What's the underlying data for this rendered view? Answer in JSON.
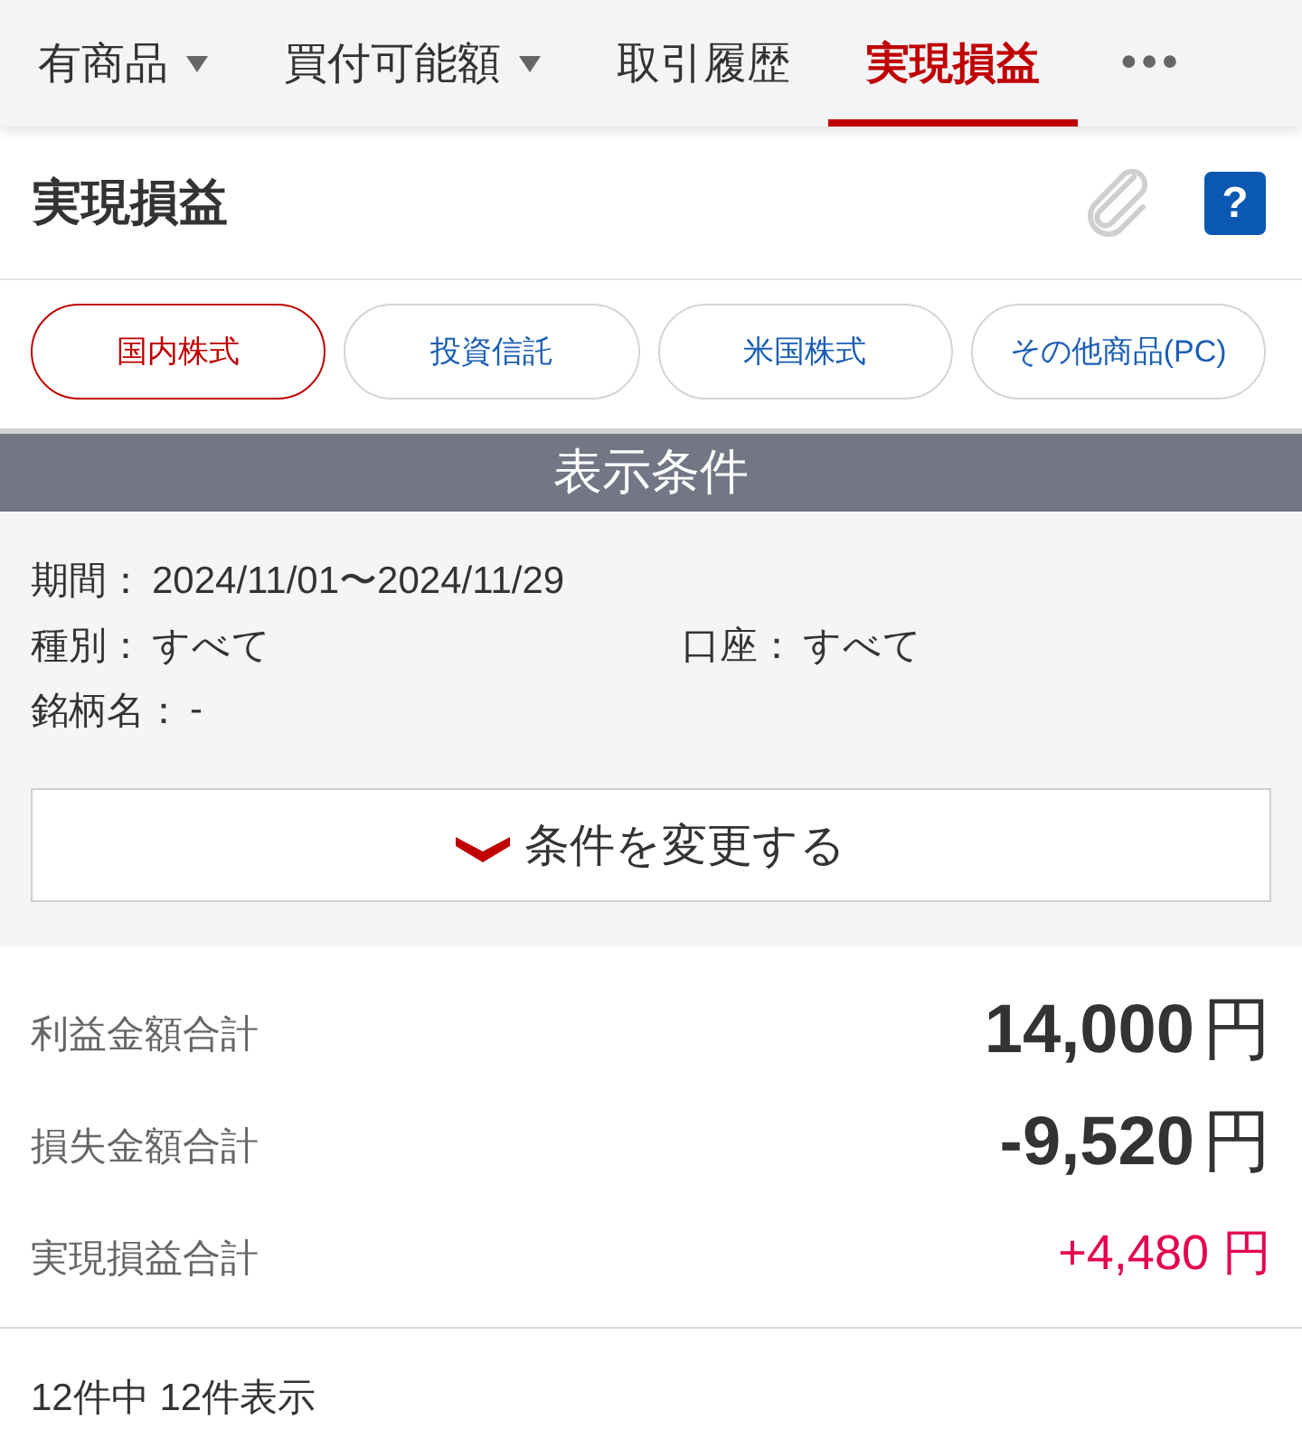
{
  "nav": {
    "tabs": [
      {
        "label": "有商品",
        "dropdown": true,
        "selected": false
      },
      {
        "label": "買付可能額",
        "dropdown": true,
        "selected": false
      },
      {
        "label": "取引履歴",
        "dropdown": false,
        "selected": false
      },
      {
        "label": "実現損益",
        "dropdown": false,
        "selected": true
      }
    ],
    "more": "•••"
  },
  "header": {
    "title": "実現損益",
    "help": "?"
  },
  "categories": [
    {
      "label": "国内株式",
      "selected": true
    },
    {
      "label": "投資信託",
      "selected": false
    },
    {
      "label": "米国株式",
      "selected": false
    },
    {
      "label": "その他商品(PC)",
      "selected": false
    }
  ],
  "conditions": {
    "title": "表示条件",
    "rows": [
      [
        {
          "label": "期間：",
          "value": "2024/11/01〜2024/11/29"
        }
      ],
      [
        {
          "label": "種別：",
          "value": "すべて"
        },
        {
          "label": "口座：",
          "value": "すべて"
        }
      ],
      [
        {
          "label": "銘柄名：",
          "value": "-"
        }
      ]
    ],
    "change_button": "条件を変更する"
  },
  "totals": [
    {
      "label": "利益金額合計",
      "amount": "14,000",
      "unit": "円",
      "kind": "large"
    },
    {
      "label": "損失金額合計",
      "amount": "-9,520",
      "unit": "円",
      "kind": "large"
    },
    {
      "label": "実現損益合計",
      "amount": "+4,480",
      "unit": "円",
      "kind": "gain"
    }
  ],
  "result_count": "12件中 12件表示"
}
